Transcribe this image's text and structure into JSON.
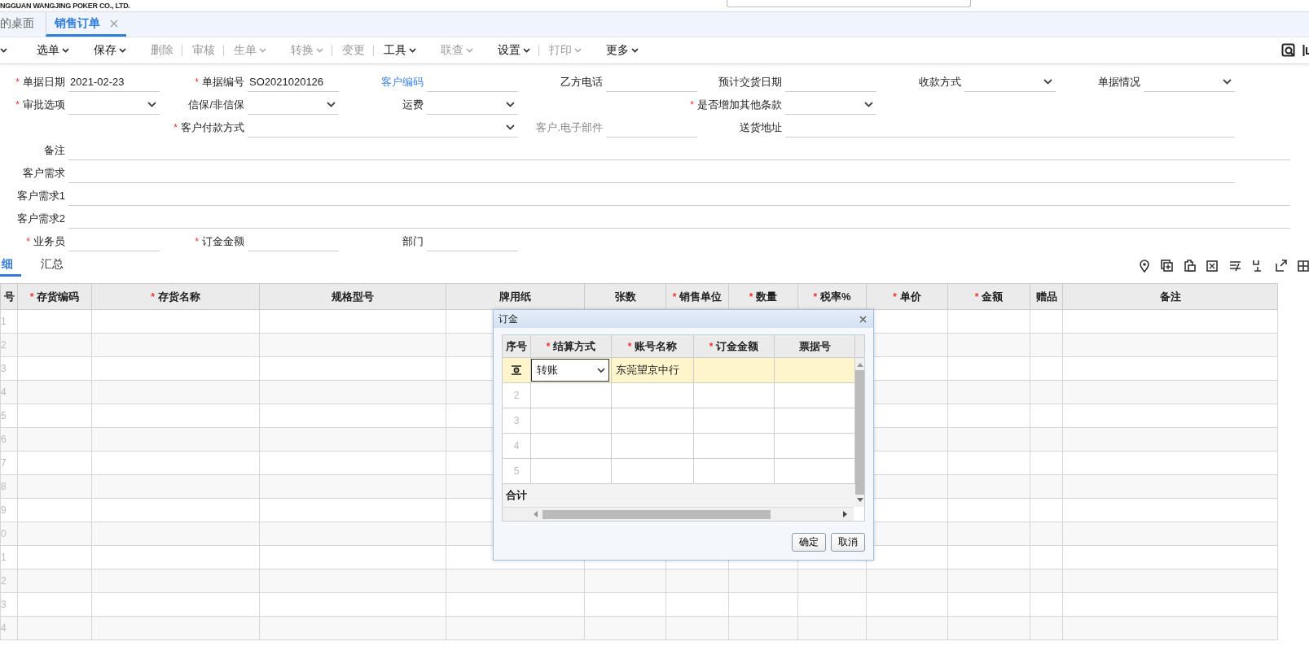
{
  "header": {
    "company": "NGGUAN WANGJING POKER CO., LTD."
  },
  "tabs": [
    {
      "label": "的桌面",
      "selected": false,
      "closable": false
    },
    {
      "label": "销售订单",
      "selected": true,
      "closable": true
    }
  ],
  "toolbar": [
    {
      "dropdown": true,
      "disabled": false,
      "separator": false
    },
    {
      "label": "选单",
      "dropdown": true,
      "disabled": false,
      "separator": false
    },
    {
      "label": "保存",
      "dropdown": true,
      "disabled": false,
      "separator": false
    },
    {
      "label": "删除",
      "dropdown": false,
      "disabled": true,
      "separator": true
    },
    {
      "label": "审核",
      "dropdown": false,
      "disabled": true,
      "separator": true
    },
    {
      "label": "生单",
      "dropdown": true,
      "disabled": true,
      "separator": false
    },
    {
      "label": "转换",
      "dropdown": true,
      "disabled": true,
      "separator": true
    },
    {
      "label": "变更",
      "dropdown": false,
      "disabled": true,
      "separator": true
    },
    {
      "label": "工具",
      "dropdown": true,
      "disabled": false,
      "separator": false
    },
    {
      "label": "联查",
      "dropdown": true,
      "disabled": true,
      "separator": false
    },
    {
      "label": "设置",
      "dropdown": true,
      "disabled": false,
      "separator": true
    },
    {
      "label": "打印",
      "dropdown": true,
      "disabled": true,
      "separator": false
    },
    {
      "label": "更多",
      "dropdown": true,
      "disabled": false,
      "separator": false
    }
  ],
  "form": {
    "rows": [
      [
        {
          "mark": "*",
          "label": "单据日期",
          "kind": "text",
          "value": "2021-02-23"
        },
        {
          "mark": "*",
          "label": "单据编号",
          "kind": "text",
          "value": "SO2021020126"
        },
        {
          "label": "客户编码",
          "link": true,
          "kind": "text"
        },
        {
          "label": "乙方电话",
          "kind": "text"
        },
        {
          "label": "预计交货日期",
          "kind": "text"
        },
        {
          "label": "收款方式",
          "kind": "select"
        },
        {
          "label": "单据情况",
          "kind": "select"
        }
      ],
      [
        {
          "mark": "*",
          "label": "审批选项",
          "kind": "select"
        },
        {
          "label": "信保/非信保",
          "kind": "select"
        },
        {
          "label": "运费",
          "kind": "select"
        },
        "",
        {
          "mark": "*",
          "label": "是否增加其他条款",
          "kind": "select"
        }
      ],
      [
        "",
        {
          "mark": "*",
          "label": "客户付款方式",
          "kind": "select",
          "wide": true
        },
        "",
        {
          "label": "客户.电子部件",
          "disabled": true,
          "kind": "text"
        },
        {
          "label": "送货地址",
          "kind": "text",
          "wide": true
        },
        "",
        ""
      ],
      [
        {
          "label": "备注",
          "kind": "text",
          "wide": true
        },
        "",
        "",
        "",
        "",
        "",
        "",
        ""
      ],
      [
        {
          "label": "客户需求",
          "kind": "text",
          "wide": true
        },
        "",
        "",
        "",
        "",
        "",
        ""
      ],
      [
        {
          "label": "客户需求1",
          "kind": "text",
          "wide": true
        },
        "",
        "",
        "",
        "",
        "",
        "",
        ""
      ],
      [
        {
          "label": "客户需求2",
          "kind": "text",
          "wide": true
        },
        "",
        "",
        "",
        "",
        "",
        "",
        ""
      ],
      [
        {
          "mark": "*",
          "label": "业务员",
          "kind": "text"
        },
        {
          "mark": "*",
          "label": "订金金额",
          "kind": "text"
        },
        {
          "label": "部门",
          "kind": "text"
        }
      ]
    ]
  },
  "detail_tabs": [
    {
      "label": "细",
      "selected": true
    },
    {
      "label": "汇总",
      "selected": false
    }
  ],
  "table": {
    "columns": [
      {
        "label": "号"
      },
      {
        "mark": "*",
        "label": "存货编码"
      },
      {
        "mark": "*",
        "label": "存货名称"
      },
      {
        "label": "规格型号"
      },
      {
        "label": "牌用纸"
      },
      {
        "label": "张数"
      },
      {
        "mark": "*",
        "label": "销售单位"
      },
      {
        "mark": "*",
        "label": "数量"
      },
      {
        "mark": "*",
        "label": "税率%"
      },
      {
        "mark": "*",
        "label": "单价"
      },
      {
        "mark": "*",
        "label": "金额"
      },
      {
        "label": "赠品"
      },
      {
        "label": "备注"
      }
    ],
    "rows": [
      "1",
      "2",
      "3",
      "4",
      "5",
      "6",
      "7",
      "8",
      "9",
      "0",
      "1",
      "2",
      "3",
      "4"
    ]
  },
  "dialog": {
    "title": "订金",
    "columns": [
      {
        "label": "序号"
      },
      {
        "mark": "*",
        "label": "结算方式"
      },
      {
        "mark": "*",
        "label": "账号名称"
      },
      {
        "mark": "*",
        "label": "订金金额"
      },
      {
        "label": "票据号"
      }
    ],
    "rows": [
      {
        "current": true,
        "method": "转账",
        "account": "东莞望京中行"
      },
      {
        "current": false,
        "number": "2"
      },
      {
        "current": false,
        "number": "3"
      },
      {
        "current": false,
        "number": "4"
      },
      {
        "current": false,
        "number": "5"
      }
    ],
    "total_label": "合计",
    "buttons": [
      "确定",
      "取消"
    ]
  }
}
